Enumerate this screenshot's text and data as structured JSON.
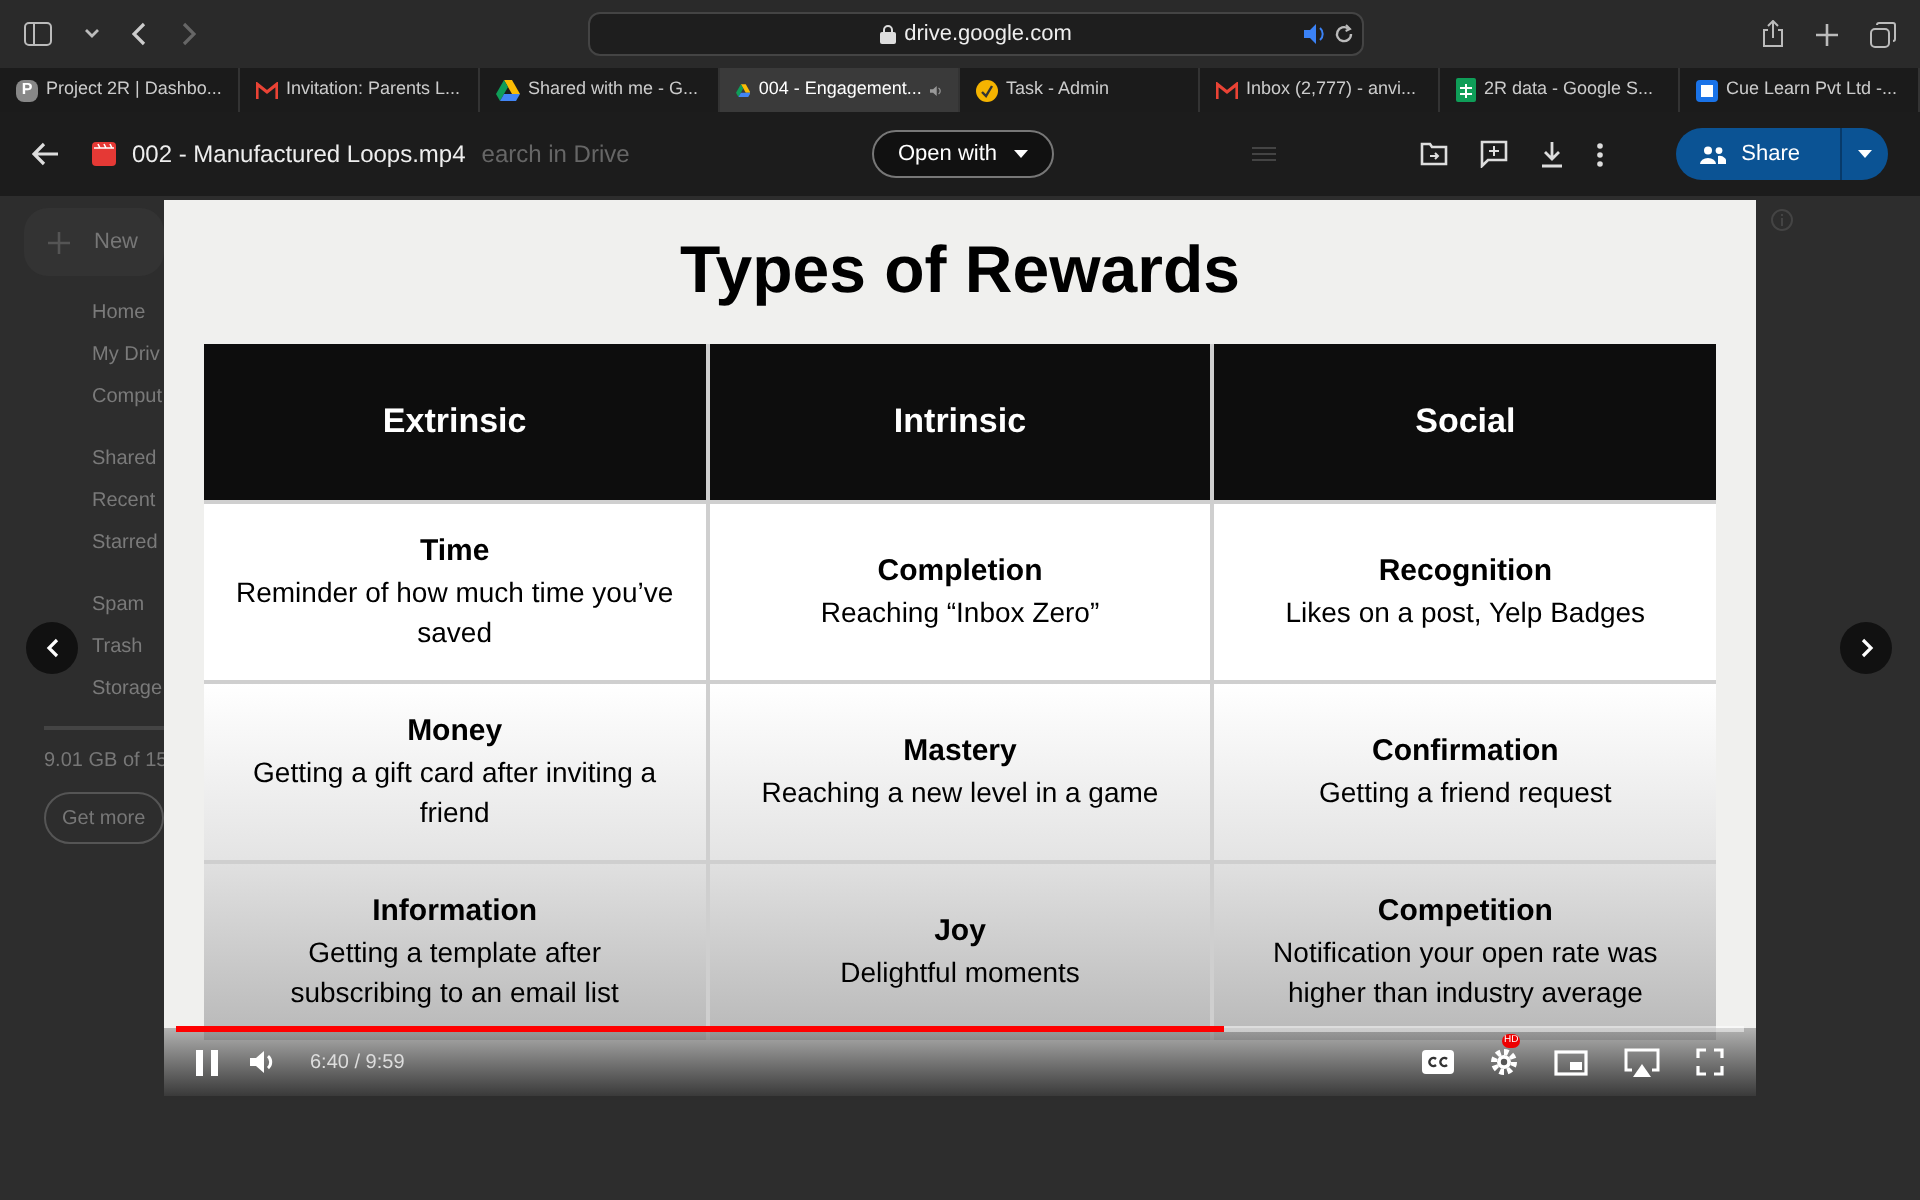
{
  "browser": {
    "url": "drive.google.com",
    "tabs": [
      {
        "title": "Project 2R | Dashbo...",
        "selected": false,
        "kind": "letter",
        "icon_text": "P",
        "audio": false
      },
      {
        "title": "Invitation: Parents L...",
        "selected": false,
        "kind": "mail",
        "audio": false
      },
      {
        "title": "Shared with me - G...",
        "selected": false,
        "kind": "drive",
        "audio": false
      },
      {
        "title": "004 - Engagement...",
        "selected": true,
        "kind": "drive",
        "audio": true
      },
      {
        "title": "Task - Admin",
        "selected": false,
        "kind": "task",
        "audio": false
      },
      {
        "title": "Inbox (2,777) - anvi...",
        "selected": false,
        "kind": "mail",
        "audio": false
      },
      {
        "title": "2R data - Google S...",
        "selected": false,
        "kind": "sheets",
        "audio": false
      },
      {
        "title": "Cue Learn Pvt Ltd -...",
        "selected": false,
        "kind": "cue",
        "audio": false
      }
    ]
  },
  "viewer": {
    "file_name": "002 - Manufactured Loops.mp4",
    "open_with": "Open with",
    "share": "Share"
  },
  "drive_background": {
    "search": "earch in Drive",
    "new": "New",
    "nav": [
      "Home",
      "My Driv",
      "Comput",
      "Shared",
      "Recent",
      "Starred",
      "Spam",
      "Trash",
      "Storage"
    ],
    "storage_text": "9.01 GB of 15",
    "get_more": "Get more"
  },
  "slide": {
    "title": "Types of Rewards",
    "columns": [
      "Extrinsic",
      "Intrinsic",
      "Social"
    ],
    "rows": [
      [
        {
          "heading": "Time",
          "text": "Reminder of how much time you’ve saved"
        },
        {
          "heading": "Completion",
          "text": "Reaching “Inbox Zero”"
        },
        {
          "heading": "Recognition",
          "text": "Likes on a post, Yelp Badges"
        }
      ],
      [
        {
          "heading": "Money",
          "text": "Getting a gift card after inviting a friend"
        },
        {
          "heading": "Mastery",
          "text": "Reaching a new level in a game"
        },
        {
          "heading": "Confirmation",
          "text": "Getting a friend request"
        }
      ],
      [
        {
          "heading": "Information",
          "text": "Getting a template after subscribing to an email list"
        },
        {
          "heading": "Joy",
          "text": "Delightful moments"
        },
        {
          "heading": "Competition",
          "text": "Notification your open rate was higher than industry average"
        }
      ]
    ]
  },
  "player": {
    "playing": true,
    "level": 0.668,
    "time": "6:40 / 9:59",
    "hd_badge": "HD"
  }
}
